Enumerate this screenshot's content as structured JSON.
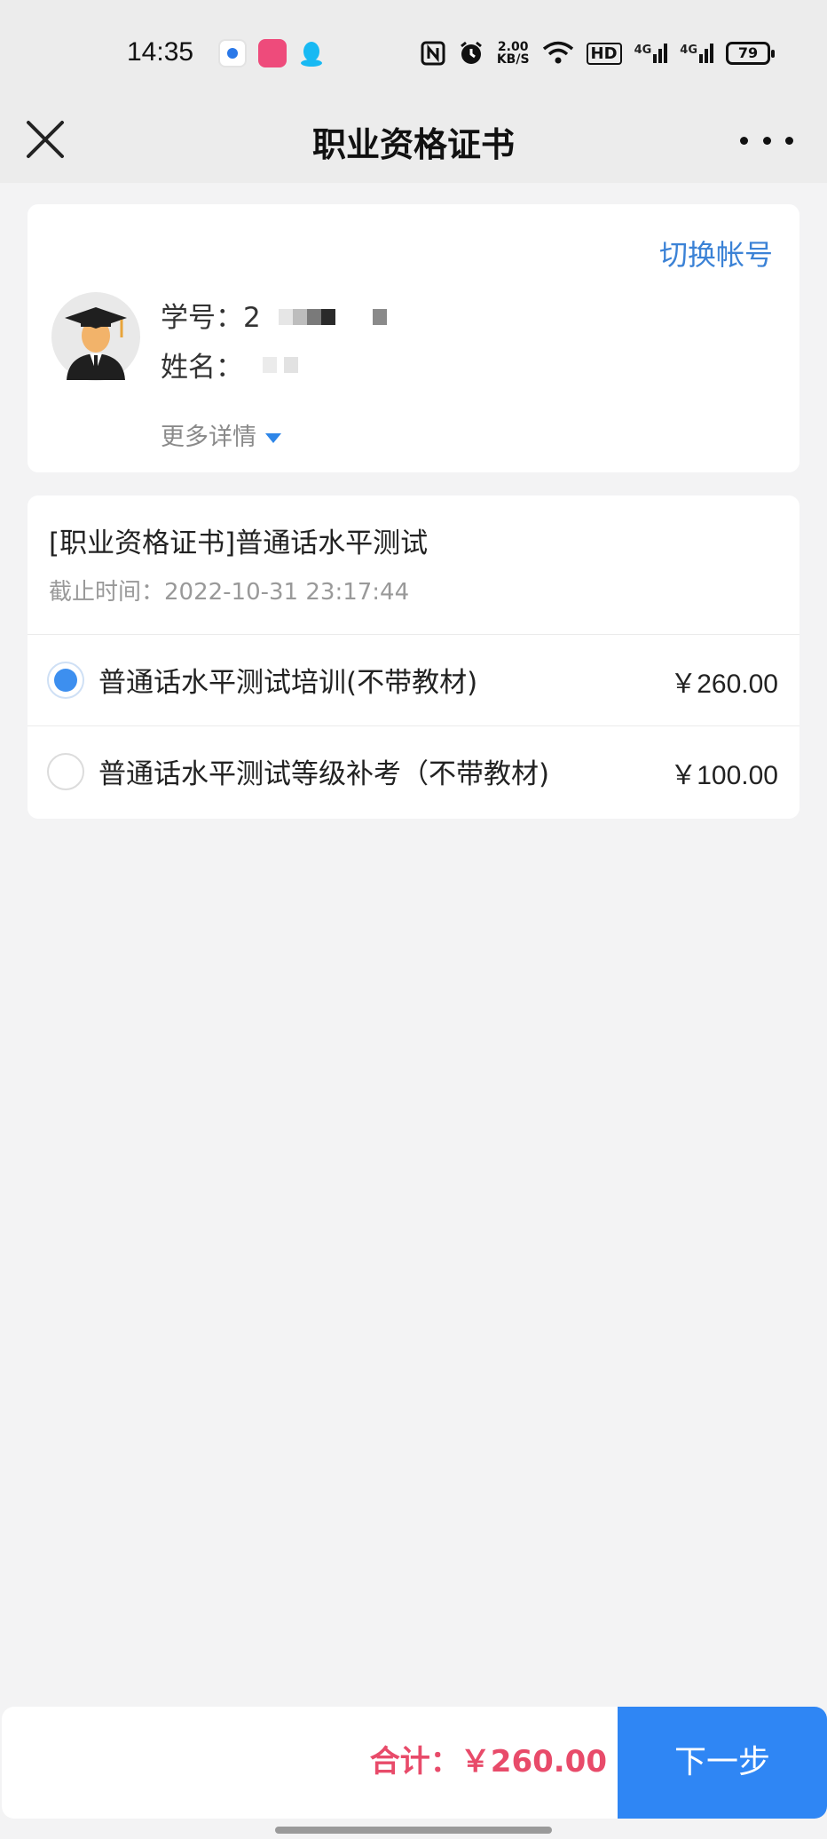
{
  "status_bar": {
    "time": "14:35",
    "net_speed_value": "2.00",
    "net_speed_unit": "KB/S",
    "hd_label": "HD",
    "signal_1": "4G",
    "signal_2": "4G",
    "battery": "79",
    "icons": [
      "app-circle-icon",
      "app-pink-icon",
      "qq-icon",
      "nfc-icon",
      "alarm-icon",
      "wifi-icon",
      "signal-icon",
      "battery-icon"
    ]
  },
  "header": {
    "title": "职业资格证书",
    "close_icon": "close-icon",
    "more_icon": "more-icon"
  },
  "user": {
    "switch_account": "切换帐号",
    "id_label": "学号：",
    "id_value": "2",
    "name_label": "姓名：",
    "more_details": "更多详情"
  },
  "course": {
    "title": "[职业资格证书]普通话水平测试",
    "deadline": "截止时间：2022-10-31 23:17:44",
    "options": [
      {
        "label": "普通话水平测试培训(不带教材)",
        "price": "￥260.00",
        "selected": true
      },
      {
        "label": "普通话水平测试等级补考（不带教材)",
        "price": "￥100.00",
        "selected": false
      }
    ]
  },
  "footer": {
    "total": "合计：￥260.00",
    "next_button": "下一步"
  },
  "colors": {
    "accent": "#2f86f4",
    "total_text": "#e84b6a",
    "link": "#3b82d6"
  }
}
